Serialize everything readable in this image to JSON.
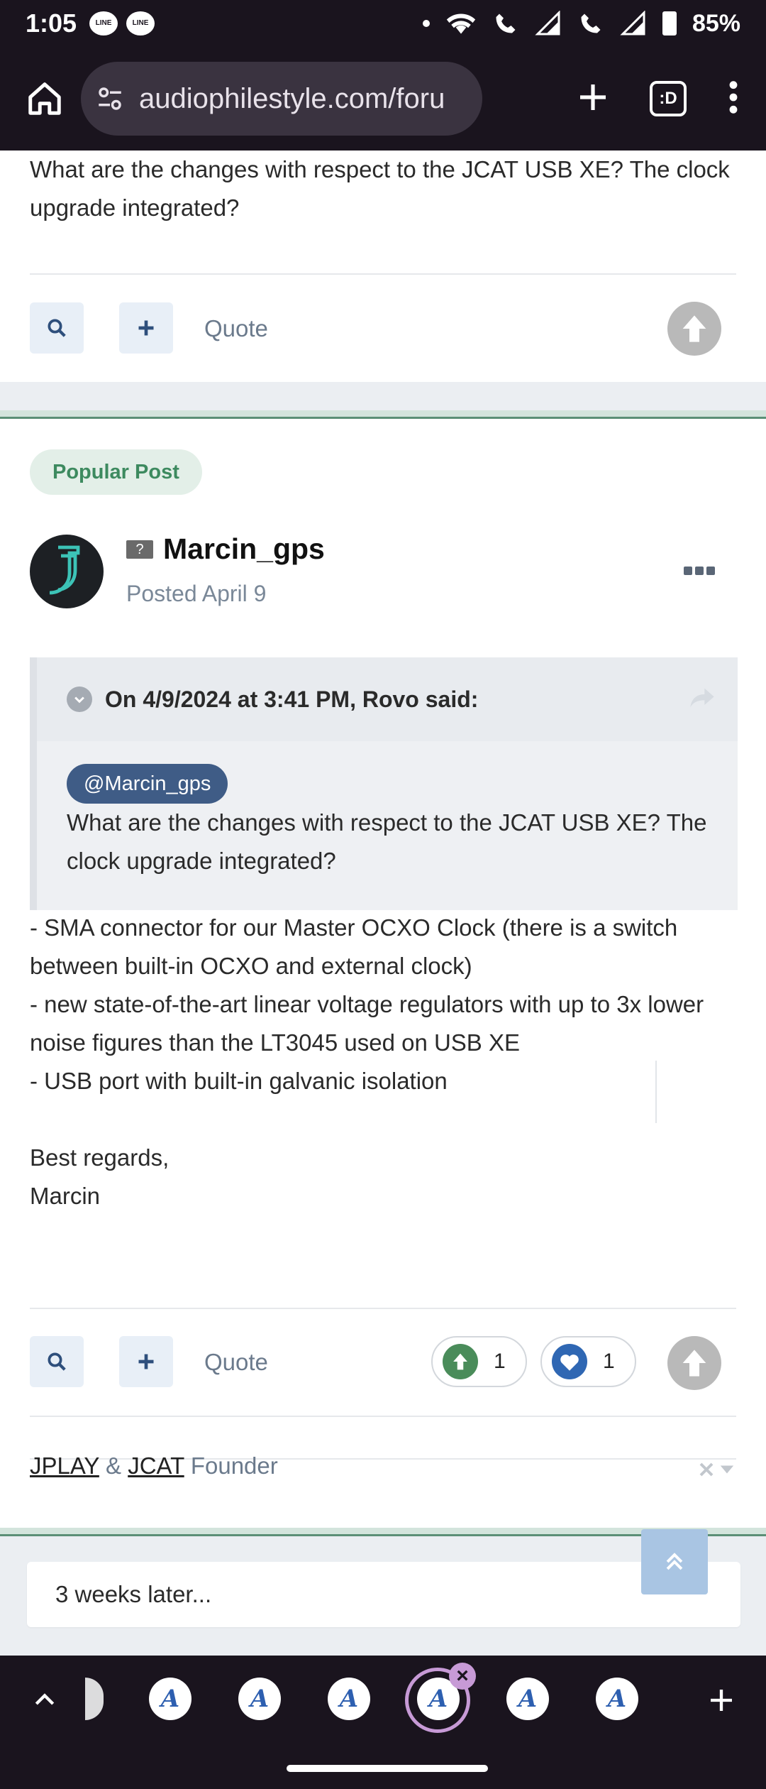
{
  "status_bar": {
    "time": "1:05",
    "line_badge": "LINE",
    "battery": "85%"
  },
  "browser": {
    "url": "audiophilestyle.com/foru",
    "tab_icon_label": ":D"
  },
  "previous_post": {
    "text": "What are the changes with respect to the JCAT USB XE? The clock upgrade integrated?",
    "quote_label": "Quote"
  },
  "post": {
    "badge": "Popular Post",
    "author": "Marcin_gps",
    "author_badge": "?",
    "posted_prefix": "Posted",
    "posted_date": "April 9",
    "quote": {
      "header": "On 4/9/2024 at 3:41 PM, Rovo said:",
      "mention": "@Marcin_gps",
      "text": "What are the changes with respect to the JCAT USB XE? The clock upgrade integrated?"
    },
    "body": {
      "line1": "- SMA connector for our Master OCXO Clock (there is a switch between built-in OCXO and external clock)",
      "line2": "- new state-of-the-art linear voltage regulators with up to 3x lower noise figures than the LT3045 used on USB XE",
      "line3": "- USB port with built-in galvanic isolation",
      "line4": "",
      "line5": "Best regards,",
      "line6": "Marcin"
    },
    "quote_label": "Quote",
    "upvotes": "1",
    "likes": "1",
    "signature": {
      "link1": "JPLAY",
      "amp": "&",
      "link2": "JCAT",
      "suffix": "Founder"
    }
  },
  "later": "3 weeks later...",
  "colors": {
    "accent": "#3f5c86",
    "popular_green": "#3d8a5f",
    "upvote_green": "#4a8c5a",
    "like_blue": "#2f67b3"
  },
  "icons": [
    "home-icon",
    "tune-icon",
    "new-tab-icon",
    "tab-switcher-icon",
    "menu-icon",
    "search-icon",
    "plus-icon",
    "upvote-icon",
    "share-icon",
    "chevron-up-icon",
    "close-icon"
  ]
}
